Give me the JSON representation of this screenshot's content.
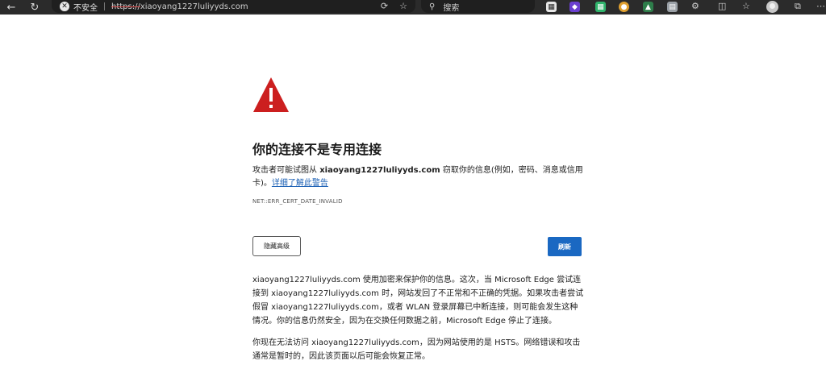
{
  "browser": {
    "insecure_label": "不安全",
    "url_scheme": "https://",
    "url_host": "xiaoyang1227luliyyds.com",
    "search_placeholder": "搜索"
  },
  "error_page": {
    "title": "你的连接不是专用连接",
    "desc_prefix": "攻击者可能试图从 ",
    "desc_host": "xiaoyang1227luliyyds.com",
    "desc_suffix": " 窃取你的信息(例如，密码、消息或信用卡)。",
    "learn_more_link": "详细了解此警告",
    "error_code": "NET::ERR_CERT_DATE_INVALID",
    "hide_advanced_button": "隐藏高级",
    "refresh_button": "刷新",
    "advanced_paragraph_1": "xiaoyang1227luliyyds.com 使用加密来保护你的信息。这次，当 Microsoft Edge 尝试连接到 xiaoyang1227luliyyds.com 时，网站发回了不正常和不正确的凭据。如果攻击者尝试假冒 xiaoyang1227luliyyds.com，或者 WLAN 登录屏幕已中断连接，则可能会发生这种情况。你的信息仍然安全，因为在交换任何数据之前，Microsoft Edge 停止了连接。",
    "advanced_paragraph_2": "你现在无法访问 xiaoyang1227luliyyds.com，因为网站使用的是 HSTS。网络错误和攻击通常是暂时的，因此该页面以后可能会恢复正常。"
  },
  "icons": {
    "back": "back-arrow-icon",
    "reload": "reload-icon",
    "warning": "warning-triangle-icon",
    "favorite": "star-icon",
    "accent_red": "#cc1f1f",
    "accent_blue": "#1a68c2"
  }
}
